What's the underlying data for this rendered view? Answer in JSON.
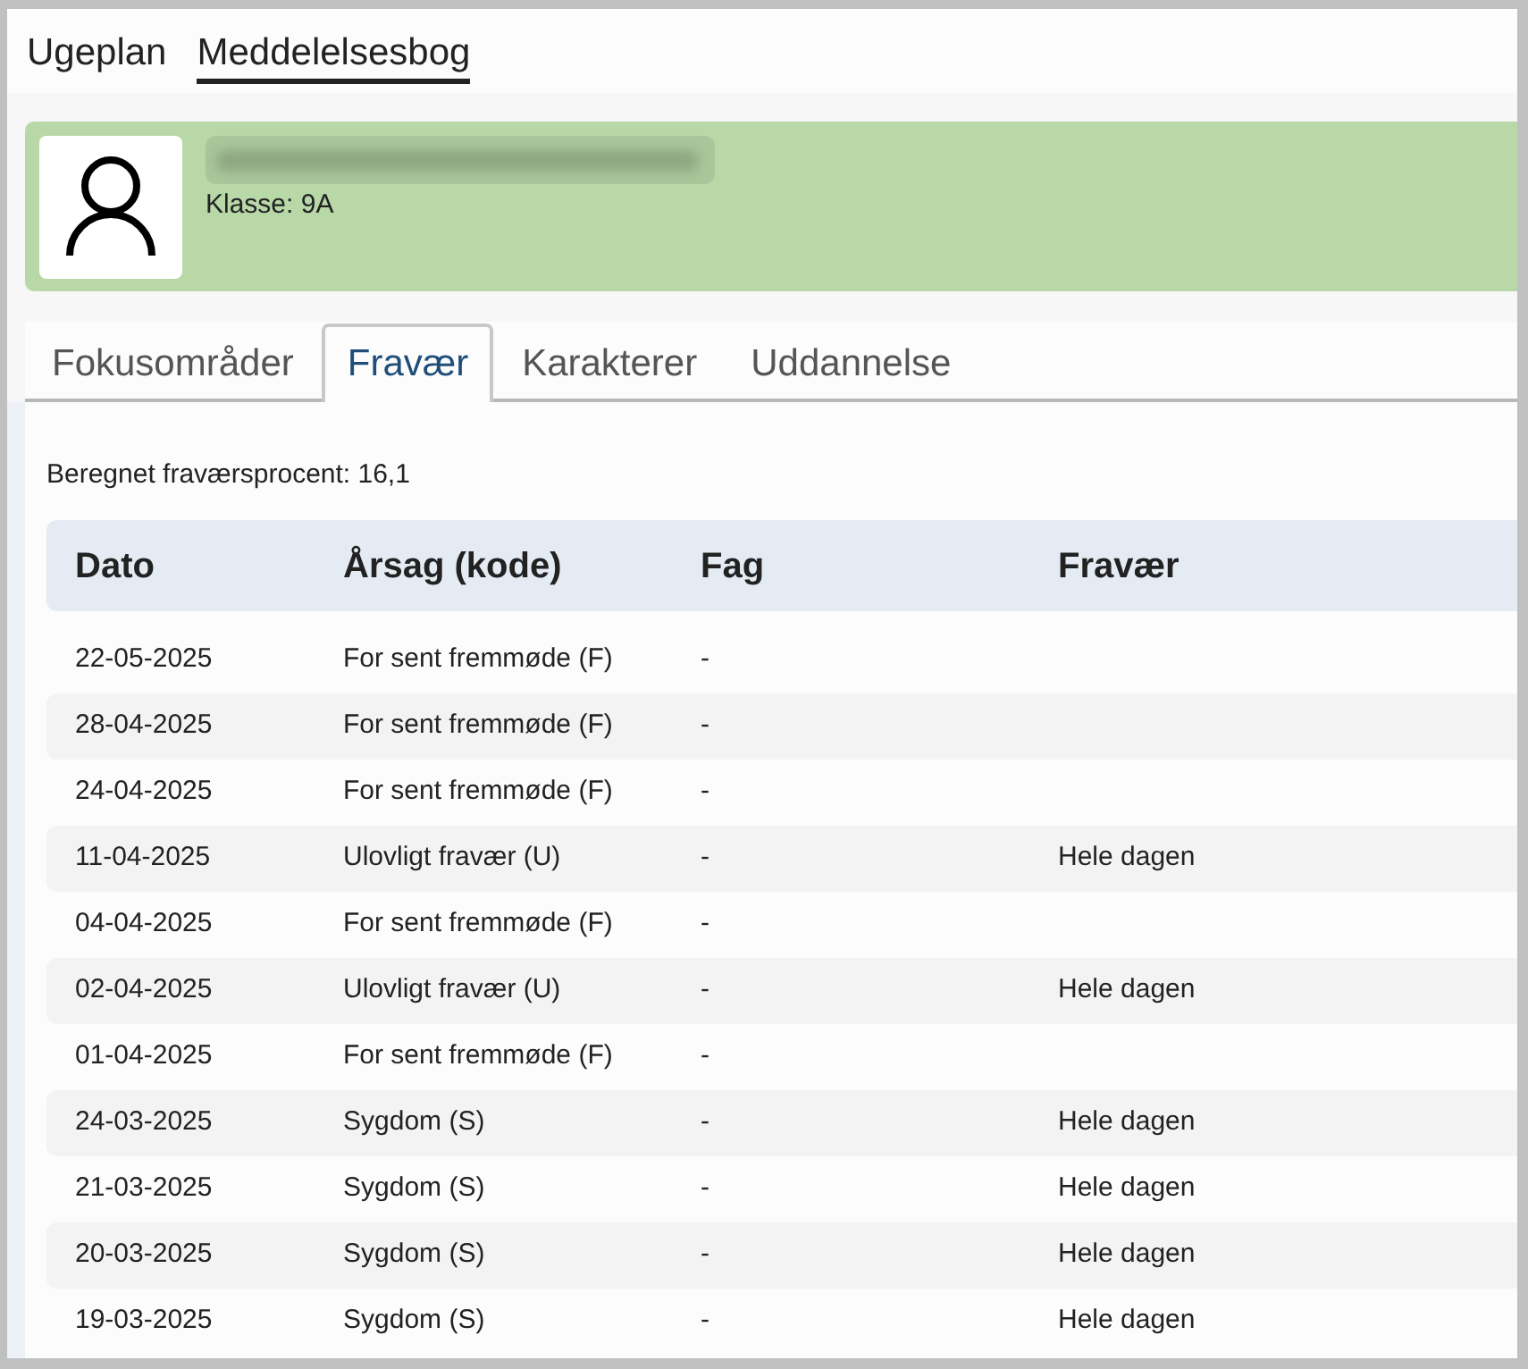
{
  "nav": [
    {
      "label": "Ugeplan",
      "selected": false
    },
    {
      "label": "Meddelelsesbog",
      "selected": true
    }
  ],
  "student": {
    "class_label": "Klasse: 9A"
  },
  "tabs": [
    {
      "label": "Fokusområder",
      "selected": false
    },
    {
      "label": "Fravær",
      "selected": true
    },
    {
      "label": "Karakterer",
      "selected": false
    },
    {
      "label": "Uddannelse",
      "selected": false
    }
  ],
  "absence_percentage": "Beregnet fraværsprocent: 16,1",
  "table": {
    "columns": [
      "Dato",
      "Årsag (kode)",
      "Fag",
      "Fravær"
    ],
    "rows": [
      {
        "date": "22-05-2025",
        "reason": "For sent fremmøde (F)",
        "subject": "-"
      },
      {
        "date": "28-04-2025",
        "reason": "For sent fremmøde (F)",
        "subject": "-"
      },
      {
        "date": "24-04-2025",
        "reason": "For sent fremmøde (F)",
        "subject": "-"
      },
      {
        "date": "11-04-2025",
        "reason": "Ulovligt fravær (U)",
        "subject": "-",
        "absence": "Hele dagen"
      },
      {
        "date": "04-04-2025",
        "reason": "For sent fremmøde (F)",
        "subject": "-"
      },
      {
        "date": "02-04-2025",
        "reason": "Ulovligt fravær (U)",
        "subject": "-",
        "absence": "Hele dagen"
      },
      {
        "date": "01-04-2025",
        "reason": "For sent fremmøde (F)",
        "subject": "-"
      },
      {
        "date": "24-03-2025",
        "reason": "Sygdom (S)",
        "subject": "-",
        "absence": "Hele dagen"
      },
      {
        "date": "21-03-2025",
        "reason": "Sygdom (S)",
        "subject": "-",
        "absence": "Hele dagen"
      },
      {
        "date": "20-03-2025",
        "reason": "Sygdom (S)",
        "subject": "-",
        "absence": "Hele dagen"
      },
      {
        "date": "19-03-2025",
        "reason": "Sygdom (S)",
        "subject": "-",
        "absence": "Hele dagen"
      }
    ]
  }
}
